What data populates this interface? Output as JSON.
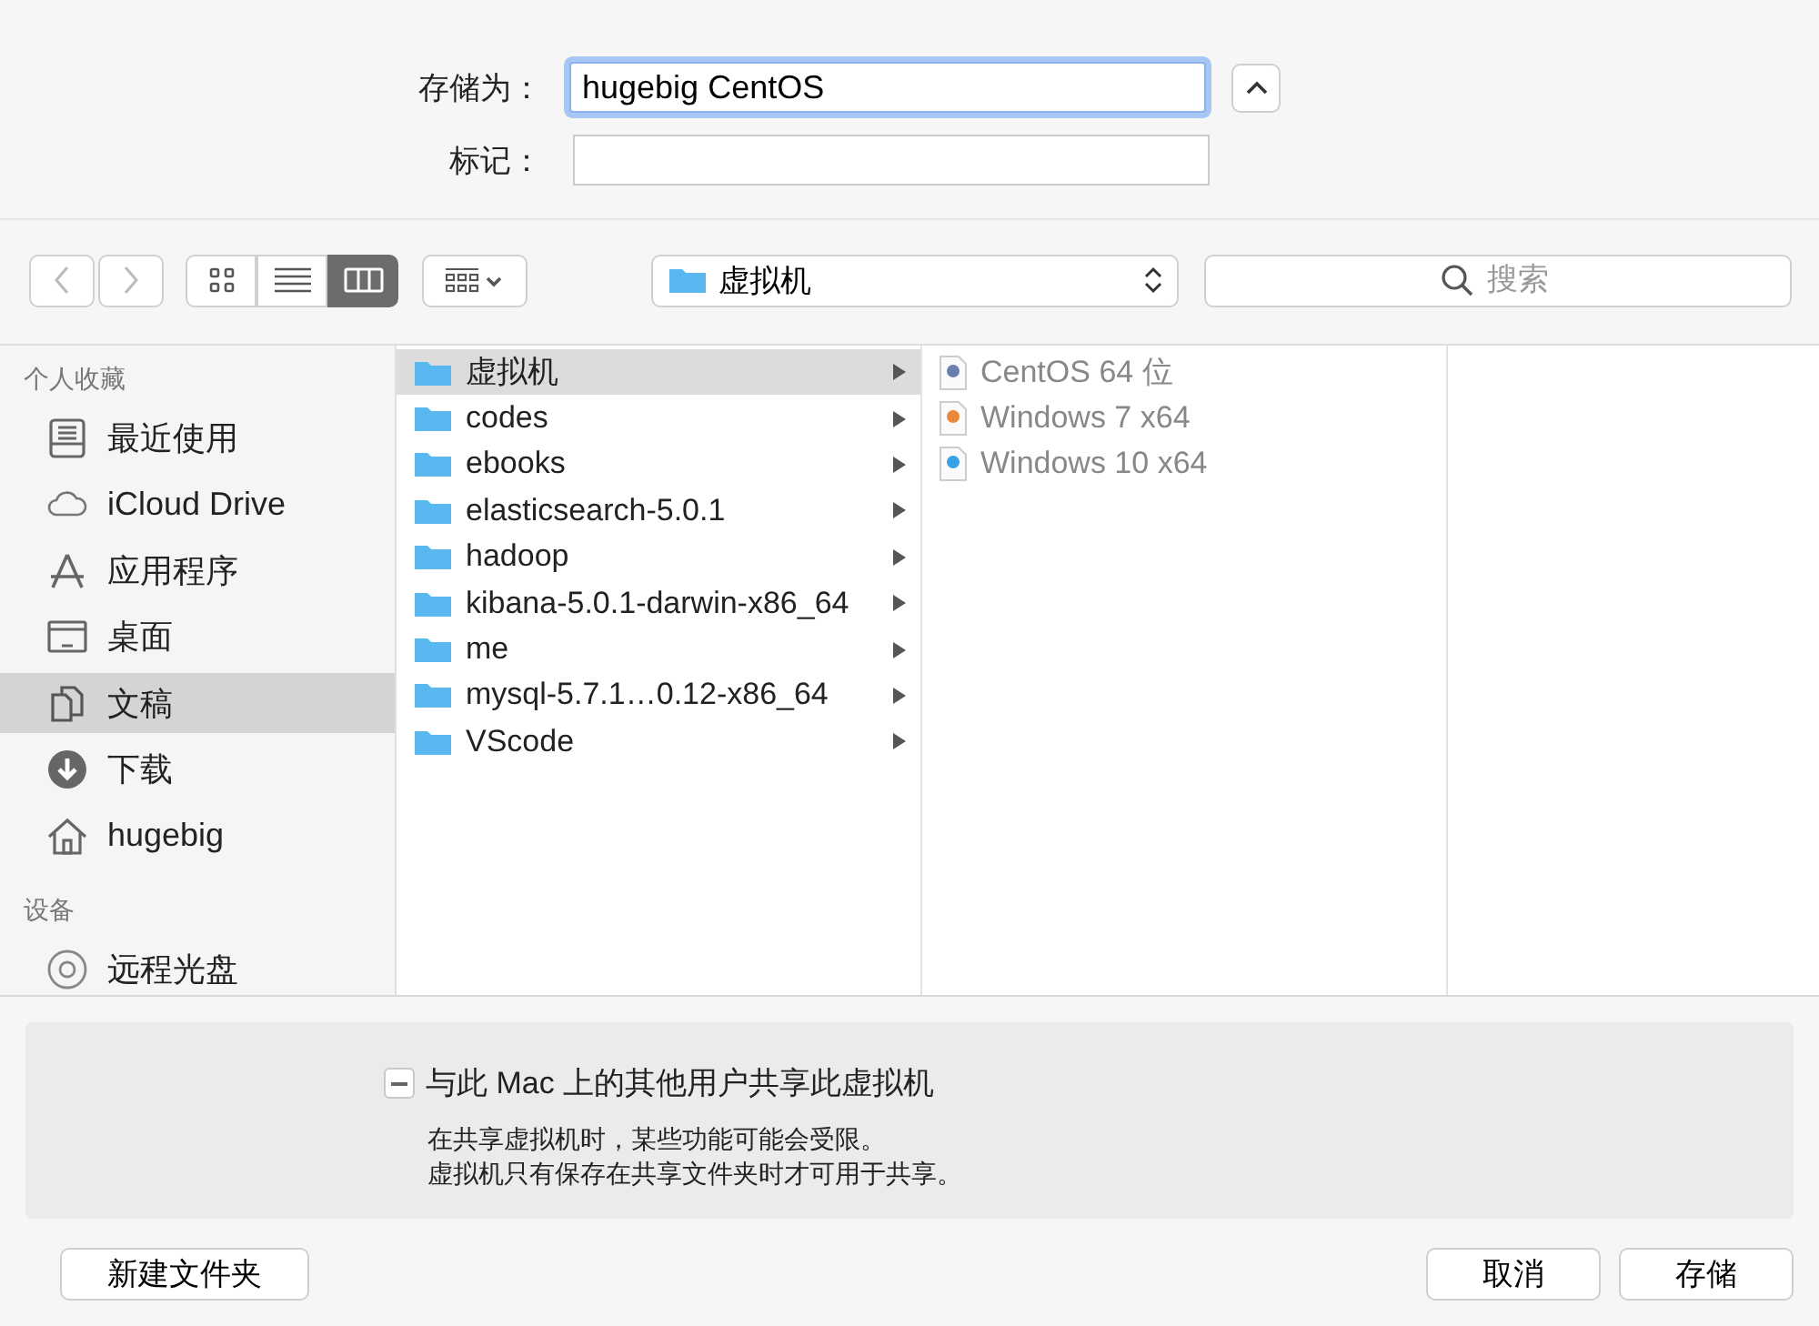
{
  "save_as": {
    "label": "存储为：",
    "value": "hugebig CentOS"
  },
  "tags": {
    "label": "标记："
  },
  "toolbar": {
    "view_modes": [
      {
        "kind": "icons",
        "selected": false
      },
      {
        "kind": "list",
        "selected": false
      },
      {
        "kind": "columns",
        "selected": true
      }
    ],
    "location": "虚拟机",
    "search": {
      "placeholder": "搜索"
    }
  },
  "sidebar": {
    "sections": [
      {
        "title": "个人收藏",
        "items": [
          {
            "label": "最近使用",
            "kind": "recents",
            "selected": false
          },
          {
            "label": "iCloud Drive",
            "kind": "cloud",
            "selected": false
          },
          {
            "label": "应用程序",
            "kind": "apps",
            "selected": false
          },
          {
            "label": "桌面",
            "kind": "desktop",
            "selected": false
          },
          {
            "label": "文稿",
            "kind": "documents",
            "selected": true
          },
          {
            "label": "下载",
            "kind": "downloads",
            "selected": false
          },
          {
            "label": "hugebig",
            "kind": "home",
            "selected": false
          }
        ]
      },
      {
        "title": "设备",
        "items": [
          {
            "label": "远程光盘",
            "kind": "disc",
            "selected": false
          }
        ]
      }
    ]
  },
  "columns": [
    {
      "items": [
        {
          "name": "虚拟机",
          "kind": "folder",
          "selected": true,
          "disabled": false
        },
        {
          "name": "codes",
          "kind": "folder",
          "selected": false,
          "disabled": false
        },
        {
          "name": "ebooks",
          "kind": "folder",
          "selected": false,
          "disabled": false
        },
        {
          "name": "elasticsearch-5.0.1",
          "kind": "folder",
          "selected": false,
          "disabled": false
        },
        {
          "name": "hadoop",
          "kind": "folder",
          "selected": false,
          "disabled": false
        },
        {
          "name": "kibana-5.0.1-darwin-x86_64",
          "kind": "folder",
          "selected": false,
          "disabled": false
        },
        {
          "name": "me",
          "kind": "folder",
          "selected": false,
          "disabled": false
        },
        {
          "name": "mysql-5.7.1…0.12-x86_64",
          "kind": "folder",
          "selected": false,
          "disabled": false
        },
        {
          "name": "VScode",
          "kind": "folder",
          "selected": false,
          "disabled": false
        }
      ]
    },
    {
      "items": [
        {
          "name": "CentOS 64 位",
          "kind": "vm",
          "color": "#6a7fb0",
          "selected": false,
          "disabled": true
        },
        {
          "name": "Windows 7 x64",
          "kind": "vm",
          "color": "#e8883a",
          "selected": false,
          "disabled": true
        },
        {
          "name": "Windows 10 x64",
          "kind": "vm",
          "color": "#3aa0e8",
          "selected": false,
          "disabled": true
        }
      ]
    }
  ],
  "share": {
    "mixed": true,
    "label": "与此 Mac 上的其他用户共享此虚拟机",
    "notes": [
      "在共享虚拟机时，某些功能可能会受限。",
      "虚拟机只有保存在共享文件夹时才可用于共享。"
    ]
  },
  "buttons": {
    "new_folder": "新建文件夹",
    "cancel": "取消",
    "save": "存储"
  }
}
